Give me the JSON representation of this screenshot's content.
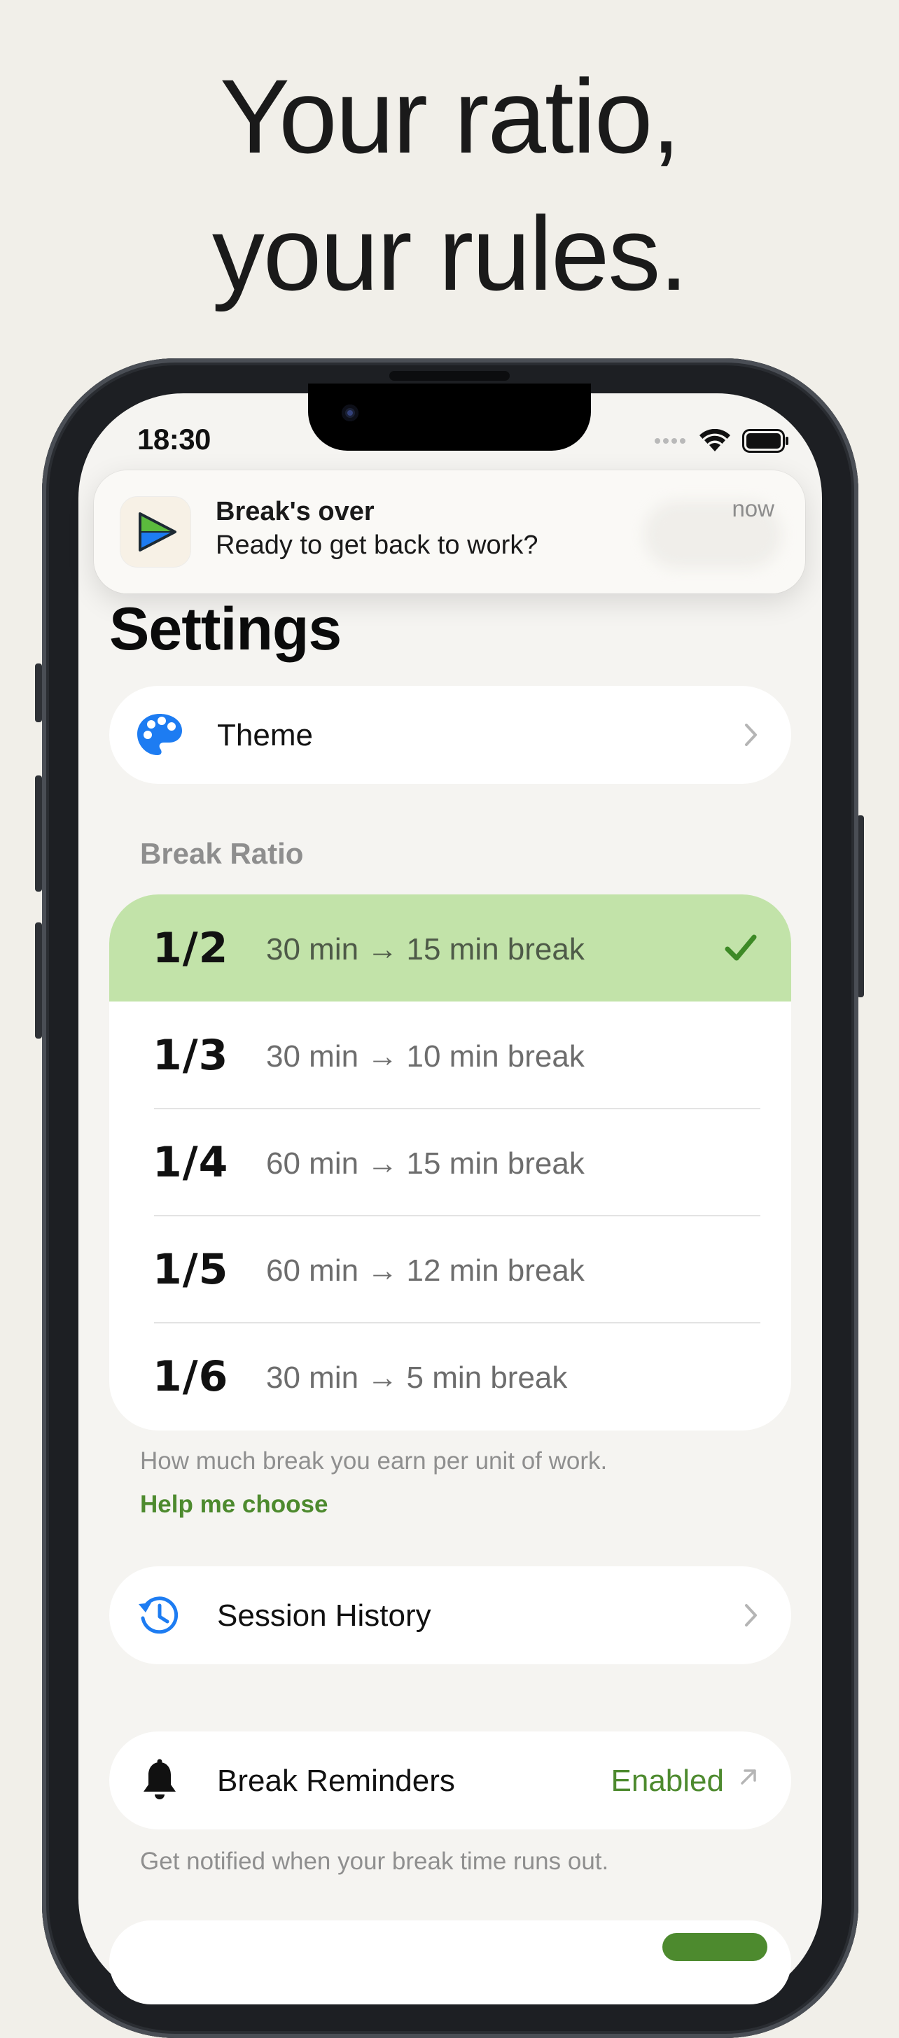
{
  "headline": {
    "line1": "Your ratio,",
    "line2": "your rules."
  },
  "status_bar": {
    "time": "18:30"
  },
  "notification": {
    "title": "Break's over",
    "body": "Ready to get back to work?",
    "time": "now",
    "app_icon": "break-ratio-app-icon"
  },
  "settings": {
    "title": "Settings",
    "theme": {
      "label": "Theme",
      "icon": "palette-icon"
    },
    "break_ratio": {
      "header": "Break Ratio",
      "options": [
        {
          "fraction": "1/2",
          "description": "30 min → 15 min break",
          "selected": true
        },
        {
          "fraction": "1/3",
          "description": "30 min → 10 min break",
          "selected": false
        },
        {
          "fraction": "1/4",
          "description": "60 min → 15 min break",
          "selected": false
        },
        {
          "fraction": "1/5",
          "description": "60 min → 12 min break",
          "selected": false
        },
        {
          "fraction": "1/6",
          "description": "30 min → 5 min break",
          "selected": false
        }
      ],
      "footnote": "How much break you earn per unit of work.",
      "help_link": "Help me choose"
    },
    "session_history": {
      "label": "Session History",
      "icon": "history-icon"
    },
    "break_reminders": {
      "label": "Break Reminders",
      "value": "Enabled",
      "icon": "bell-icon",
      "footnote": "Get notified when your break time runs out."
    }
  },
  "colors": {
    "background": "#f1efe9",
    "selected_row": "#c2e3a9",
    "accent_green": "#4d8a2e",
    "icon_blue": "#1d7cf2"
  }
}
